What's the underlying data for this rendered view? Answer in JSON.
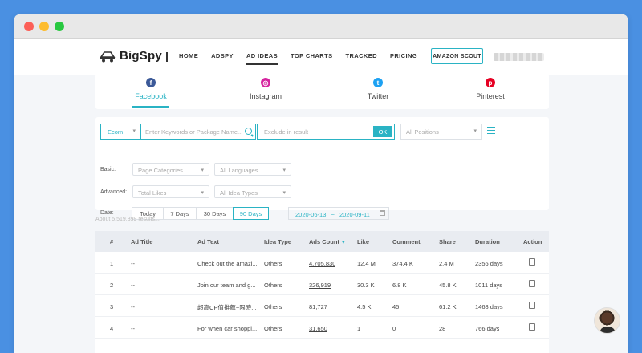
{
  "app": {
    "logo_text": "BigSpy",
    "nav": [
      "HOME",
      "ADSPY",
      "AD IDEAS",
      "TOP CHARTS",
      "TRACKED",
      "PRICING"
    ],
    "nav_active": "AD IDEAS",
    "amazon_btn": "AMAZON SCOUT"
  },
  "platforms": [
    {
      "label": "Facebook",
      "icon": "facebook-icon",
      "color": "#3b5998",
      "glyph": "f",
      "active": true
    },
    {
      "label": "Instagram",
      "icon": "instagram-icon",
      "color": "#d6249f",
      "glyph": "◎",
      "active": false
    },
    {
      "label": "Twitter",
      "icon": "twitter-icon",
      "color": "#1da1f2",
      "glyph": "t",
      "active": false
    },
    {
      "label": "Pinterest",
      "icon": "pinterest-icon",
      "color": "#e60023",
      "glyph": "p",
      "active": false
    }
  ],
  "filters": {
    "ecom": "Ecom",
    "keyword_placeholder": "Enter Keywords or Package Name...",
    "exclude_placeholder": "Exclude in result",
    "ok": "OK",
    "positions": "All Positions",
    "basic_label": "Basic:",
    "page_categories": "Page Categories",
    "languages": "All Languages",
    "advanced_label": "Advanced:",
    "total_likes": "Total Likes",
    "idea_types": "All Idea Types",
    "date_label": "Date:",
    "date_tabs": [
      "Today",
      "7 Days",
      "30 Days",
      "90 Days"
    ],
    "date_active": "90 Days",
    "date_start": "2020-06-13",
    "date_sep": "~",
    "date_end": "2020-09-11"
  },
  "results_text": "About 5,519,399 results...",
  "table": {
    "headers": [
      "#",
      "Ad Title",
      "Ad Text",
      "Idea Type",
      "Ads Count",
      "Like",
      "Comment",
      "Share",
      "Duration",
      "Action"
    ],
    "rows": [
      {
        "n": "1",
        "title": "--",
        "text": "Check out the amazi...",
        "type": "Others",
        "count": "4,705,830",
        "like": "12.4 M",
        "comment": "374.4 K",
        "share": "2.4 M",
        "duration": "2356 days"
      },
      {
        "n": "2",
        "title": "--",
        "text": "Join our team and g...",
        "type": "Others",
        "count": "326,919",
        "like": "30.3 K",
        "comment": "6.8 K",
        "share": "45.8 K",
        "duration": "1011 days"
      },
      {
        "n": "3",
        "title": "--",
        "text": "超高CP值推薦~限時...",
        "type": "Others",
        "count": "81,727",
        "like": "4.5 K",
        "comment": "45",
        "share": "61.2 K",
        "duration": "1468 days"
      },
      {
        "n": "4",
        "title": "--",
        "text": "For when car shoppi...",
        "type": "Others",
        "count": "31,650",
        "like": "1",
        "comment": "0",
        "share": "28",
        "duration": "766 days"
      }
    ]
  },
  "colors": {
    "accent": "#2ab3c4",
    "background": "#4a90e2"
  }
}
